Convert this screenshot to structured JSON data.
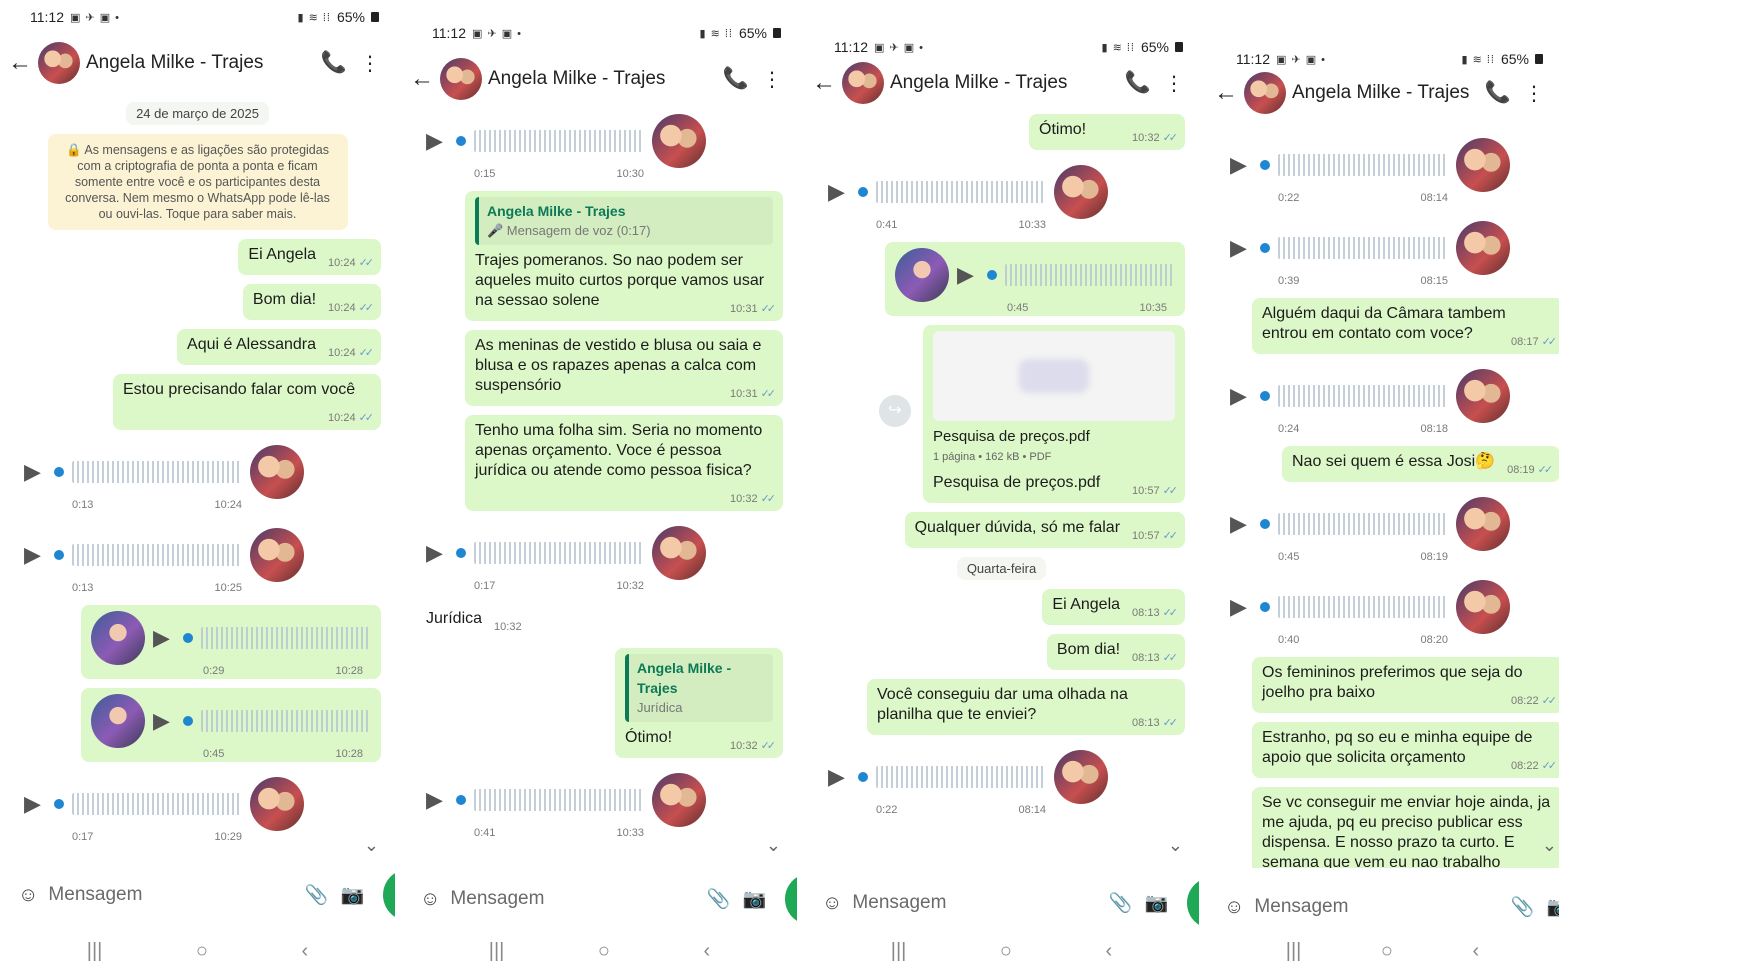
{
  "colors": {
    "outgoing_bubble": "#dcf7c8",
    "accent_green": "#1fa855",
    "read_ticks": "#6a9bcb",
    "audio_dot": "#1f86d1",
    "quote_name": "#0c7a56"
  },
  "icons": {
    "back": "←",
    "call_add": "📞",
    "more": "⋮",
    "play": "▶",
    "emoji": "☺",
    "attach": "📎",
    "camera": "📷",
    "mic": "🎤",
    "chevron_down": "⌄",
    "forward": "↪",
    "nav_recents": "|||",
    "nav_home": "○",
    "nav_back": "‹",
    "ticks": "✓✓"
  },
  "contact_name": "Angela Milke - Trajes",
  "composer_placeholder": "Mensagem",
  "screens": [
    {
      "status": {
        "time": "11:12",
        "battery": "65%"
      },
      "date_chip": "24 de março de 2025",
      "encryption_notice": "🔒 As mensagens e as ligações são protegidas com a criptografia de ponta a ponta e ficam somente entre você e os participantes desta conversa. Nem mesmo o WhatsApp pode lê-las ou ouvi-las. Toque para saber mais.",
      "messages": [
        {
          "text": "Ei Angela",
          "time": "10:24"
        },
        {
          "text": "Bom dia!",
          "time": "10:24"
        },
        {
          "text": "Aqui é Alessandra",
          "time": "10:24"
        },
        {
          "text": "Estou precisando falar com você",
          "time": "10:24"
        }
      ],
      "audios_in": [
        {
          "duration": "0:13",
          "time": "10:24"
        },
        {
          "duration": "0:13",
          "time": "10:25"
        }
      ],
      "audios_out": [
        {
          "duration": "0:29",
          "time": "10:28"
        },
        {
          "duration": "0:45",
          "time": "10:28"
        }
      ],
      "audio_last": {
        "duration": "0:17",
        "time": "10:29"
      }
    },
    {
      "status": {
        "time": "11:12",
        "battery": "65%"
      },
      "audio_top": {
        "duration": "0:15",
        "time": "10:30"
      },
      "quote1": {
        "name": "Angela Milke - Trajes",
        "text": "🎤 Mensagem de voz (0:17)"
      },
      "messages": [
        {
          "text": "Trajes pomeranos. So nao podem ser aqueles muito curtos porque vamos usar na sessao solene",
          "time": "10:31"
        },
        {
          "text": "As meninas de vestido e blusa ou saia e blusa e os rapazes apenas a calca com suspensório",
          "time": "10:31"
        },
        {
          "text": "Tenho uma folha sim. Seria no momento apenas orçamento. Voce é pessoa jurídica ou atende como pessoa fisica?",
          "time": "10:32"
        }
      ],
      "audio_mid": {
        "duration": "0:17",
        "time": "10:32"
      },
      "incoming_text": {
        "text": "Jurídica",
        "time": "10:32"
      },
      "quote2": {
        "name": "Angela Milke - Trajes",
        "text": "Jurídica"
      },
      "reply": {
        "text": "Ótimo!",
        "time": "10:32"
      },
      "audio_bottom": {
        "duration": "0:41",
        "time": "10:33"
      }
    },
    {
      "status": {
        "time": "11:12",
        "battery": "65%"
      },
      "top_msg": {
        "text": "Ótimo!",
        "time": "10:32"
      },
      "audio_in": {
        "duration": "0:41",
        "time": "10:33"
      },
      "audio_out": {
        "duration": "0:45",
        "time": "10:35"
      },
      "doc": {
        "name": "Pesquisa de preços.pdf",
        "sub": "1 página • 162 kB • PDF",
        "caption": "Pesquisa de preços.pdf",
        "time": "10:57"
      },
      "msg_duvida": {
        "text": "Qualquer dúvida, só me falar",
        "time": "10:57"
      },
      "day_chip": "Quarta-feira",
      "messages": [
        {
          "text": "Ei Angela",
          "time": "08:13"
        },
        {
          "text": "Bom dia!",
          "time": "08:13"
        },
        {
          "text": "Você conseguiu dar uma olhada na planilha que te enviei?",
          "time": "08:13"
        }
      ],
      "audio_last": {
        "duration": "0:22",
        "time": "08:14"
      }
    },
    {
      "status": {
        "time": "11:12",
        "battery": "65%"
      },
      "audio1": {
        "duration": "0:22",
        "time": "08:14"
      },
      "audio2": {
        "duration": "0:39",
        "time": "08:15"
      },
      "msg1": {
        "text": "Alguém daqui da Câmara tambem entrou em contato com voce?",
        "time": "08:17"
      },
      "audio3": {
        "duration": "0:24",
        "time": "08:18"
      },
      "msg2": {
        "text": "Nao sei quem é essa Josi🤔",
        "time": "08:19"
      },
      "audio4": {
        "duration": "0:45",
        "time": "08:19"
      },
      "audio5": {
        "duration": "0:40",
        "time": "08:20"
      },
      "messages": [
        {
          "text": "Os femininos preferimos que seja do joelho pra baixo",
          "time": "08:22"
        },
        {
          "text": "Estranho, pq so eu e minha equipe de apoio que solicita orçamento",
          "time": "08:22"
        },
        {
          "text": "Se vc conseguir me enviar hoje ainda, ja me ajuda, pq eu preciso publicar ess dispensa. E nosso prazo ta curto. E semana que vem eu nao trabalho",
          "time": ""
        }
      ]
    }
  ]
}
